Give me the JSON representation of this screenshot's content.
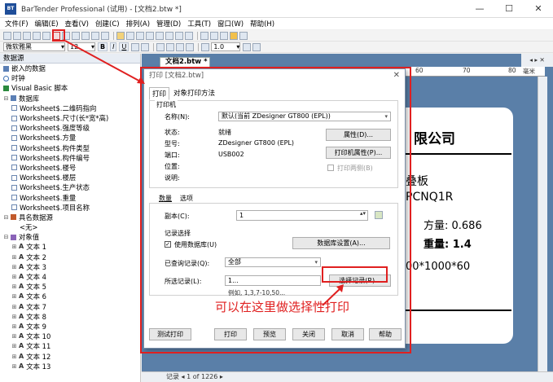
{
  "window": {
    "title": "BarTender Professional (试用) - [文档2.btw *]",
    "app_icon_text": "BT",
    "minimize": "—",
    "maximize": "☐",
    "close": "✕"
  },
  "menu": [
    "文件(F)",
    "编辑(E)",
    "查看(V)",
    "创建(C)",
    "排列(A)",
    "管理(D)",
    "工具(T)",
    "窗口(W)",
    "帮助(H)"
  ],
  "toolbar2": {
    "font_name": "微软雅黑",
    "font_size": "12",
    "bold": "B",
    "italic": "I",
    "underline": "U",
    "line_width": "1.0"
  },
  "left_panel": {
    "header": "数据源",
    "items": [
      {
        "text": "嵌入的数据",
        "icon": "db-icon",
        "indent": 0,
        "expander": ""
      },
      {
        "text": "时钟",
        "icon": "clock-icon",
        "indent": 0,
        "expander": ""
      },
      {
        "text": "Visual Basic 脚本",
        "icon": "vb-icon",
        "indent": 0,
        "expander": ""
      },
      {
        "text": "数据库",
        "icon": "db-icon",
        "indent": 0,
        "expander": "⊟"
      },
      {
        "text": "Worksheet$.二维码指向",
        "icon": "field-icon",
        "indent": 1,
        "expander": ""
      },
      {
        "text": "Worksheet$.尺寸(长*宽*高)",
        "icon": "field-icon",
        "indent": 1,
        "expander": ""
      },
      {
        "text": "Worksheet$.强度等级",
        "icon": "field-icon",
        "indent": 1,
        "expander": ""
      },
      {
        "text": "Worksheet$.方量",
        "icon": "field-icon",
        "indent": 1,
        "expander": ""
      },
      {
        "text": "Worksheet$.构件类型",
        "icon": "field-icon",
        "indent": 1,
        "expander": ""
      },
      {
        "text": "Worksheet$.构件编号",
        "icon": "field-icon",
        "indent": 1,
        "expander": ""
      },
      {
        "text": "Worksheet$.楼号",
        "icon": "field-icon",
        "indent": 1,
        "expander": ""
      },
      {
        "text": "Worksheet$.楼层",
        "icon": "field-icon",
        "indent": 1,
        "expander": ""
      },
      {
        "text": "Worksheet$.生产状态",
        "icon": "field-icon",
        "indent": 1,
        "expander": ""
      },
      {
        "text": "Worksheet$.重量",
        "icon": "field-icon",
        "indent": 1,
        "expander": ""
      },
      {
        "text": "Worksheet$.项目名称",
        "icon": "field-icon",
        "indent": 1,
        "expander": ""
      },
      {
        "text": "具名数据源",
        "icon": "named-icon",
        "indent": 0,
        "expander": "⊟"
      },
      {
        "text": "<无>",
        "icon": "",
        "indent": 2,
        "expander": ""
      },
      {
        "text": "对象值",
        "icon": "object-icon",
        "indent": 0,
        "expander": "⊟"
      },
      {
        "text": "文本 1",
        "icon": "text-icon",
        "indent": 1,
        "expander": "⊞"
      },
      {
        "text": "文本 2",
        "icon": "text-icon",
        "indent": 1,
        "expander": "⊞"
      },
      {
        "text": "文本 3",
        "icon": "text-icon",
        "indent": 1,
        "expander": "⊞"
      },
      {
        "text": "文本 4",
        "icon": "text-icon",
        "indent": 1,
        "expander": "⊞"
      },
      {
        "text": "文本 5",
        "icon": "text-icon",
        "indent": 1,
        "expander": "⊞"
      },
      {
        "text": "文本 6",
        "icon": "text-icon",
        "indent": 1,
        "expander": "⊞"
      },
      {
        "text": "文本 7",
        "icon": "text-icon",
        "indent": 1,
        "expander": "⊞"
      },
      {
        "text": "文本 8",
        "icon": "text-icon",
        "indent": 1,
        "expander": "⊞"
      },
      {
        "text": "文本 9",
        "icon": "text-icon",
        "indent": 1,
        "expander": "⊞"
      },
      {
        "text": "文本 10",
        "icon": "text-icon",
        "indent": 1,
        "expander": "⊞"
      },
      {
        "text": "文本 11",
        "icon": "text-icon",
        "indent": 1,
        "expander": "⊞"
      },
      {
        "text": "文本 12",
        "icon": "text-icon",
        "indent": 1,
        "expander": "⊞"
      },
      {
        "text": "文本 13",
        "icon": "text-icon",
        "indent": 1,
        "expander": "⊞"
      }
    ]
  },
  "document": {
    "tab": "文档2.btw *",
    "ruler_labels": [
      "60",
      "70",
      "80"
    ],
    "ruler_unit": "毫米",
    "label_lines": {
      "company": "限公司",
      "type": "叠板",
      "code": "PCNQ1R",
      "volume": "方量: 0.686",
      "weight": "重量: 1.4",
      "size": "00*1000*60"
    },
    "bottom_bar": "记录  ◂  1  of  1226  ▸"
  },
  "dialog": {
    "title": "打印 [文档2.btw]",
    "close": "✕",
    "tabs": [
      "打印",
      "对象打印方法"
    ],
    "printer_group": "打印机",
    "name_label": "名称(N):",
    "name_value": "默认(当前 ZDesigner GT800 (EPL))",
    "status_label": "状态:",
    "status_value": "就绪",
    "model_label": "型号:",
    "model_value": "ZDesigner GT800 (EPL)",
    "port_label": "端口:",
    "port_value": "USB002",
    "location_label": "位置:",
    "comment_label": "说明:",
    "properties_btn": "属性(D)...",
    "printer_props_btn": "打印机属性(P)...",
    "print_both_sides": "打印两侧(B)",
    "qty_tabs": [
      "数量",
      "选项"
    ],
    "copies_label": "副本(C):",
    "copies_value": "1",
    "record_group": "记录选择",
    "use_db_label": "使用数据库(U)",
    "db_settings_btn": "数据库设置(A)...",
    "query_label": "已查询记录(Q):",
    "query_value": "全部",
    "selected_label": "所选记录(L):",
    "selected_value": "1...",
    "select_records_btn": "选择记录(R)...",
    "example": "例如,  1,3,7-10,50...",
    "footer_buttons": [
      "测试打印",
      "打印",
      "预览",
      "关闭",
      "取消",
      "帮助"
    ]
  },
  "annotation": {
    "text": "可以在这里做选择性打印",
    "color": "#e02020"
  }
}
